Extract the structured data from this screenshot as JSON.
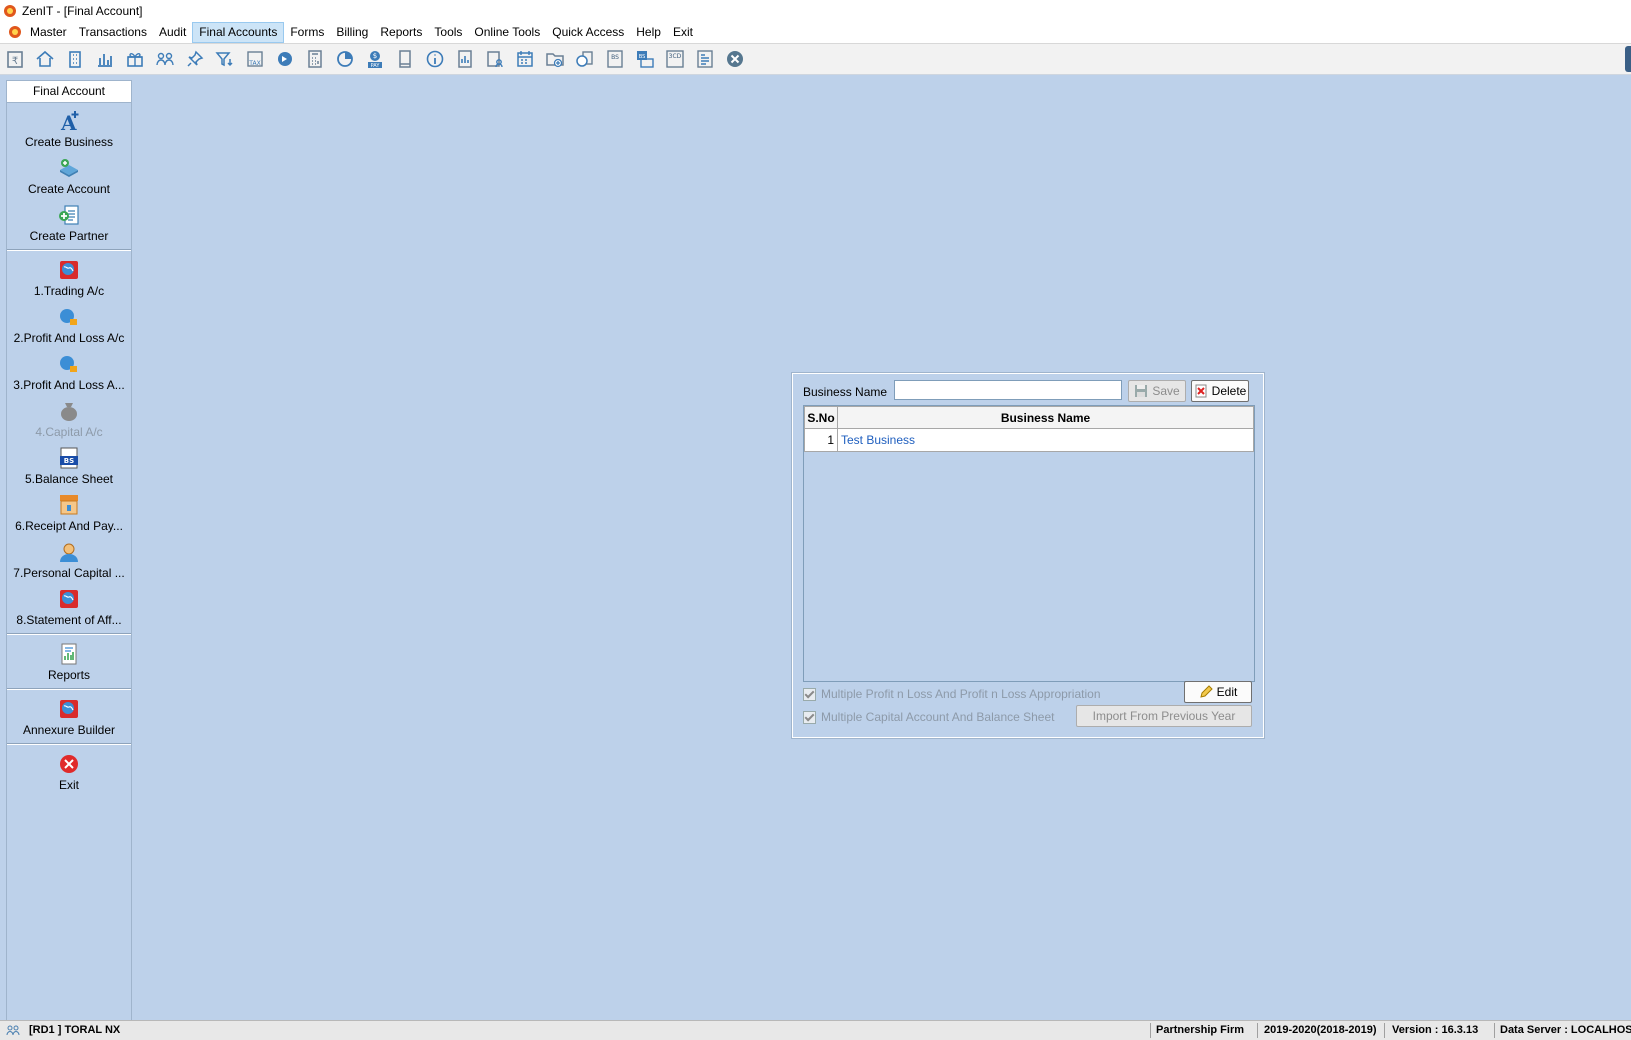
{
  "window": {
    "title": "ZenIT - [Final Account]"
  },
  "menu": {
    "items": [
      "Master",
      "Transactions",
      "Audit",
      "Final Accounts",
      "Forms",
      "Billing",
      "Reports",
      "Tools",
      "Online Tools",
      "Quick Access",
      "Help",
      "Exit"
    ],
    "active": "Final Accounts"
  },
  "toolbar": {
    "icons": [
      "rupee-ledger-icon",
      "home-icon",
      "building-icon",
      "bar-chart-icon",
      "gift-icon",
      "users-icon",
      "pin-icon",
      "filter-icon",
      "tax-icon",
      "refresh-icon",
      "calculator-icon",
      "pie-icon",
      "pay-icon",
      "book-icon",
      "info-icon",
      "report-icon",
      "user-card-icon",
      "calendar-icon",
      "folder-add-icon",
      "chart-circle-icon",
      "bs-icon",
      "bs-group-icon",
      "3cd-icon",
      "document-list-icon",
      "close-circle-icon"
    ]
  },
  "sidebar": {
    "header": "Final Account",
    "items": [
      {
        "label": "Create Business",
        "icon": "create-business-icon"
      },
      {
        "label": "Create Account",
        "icon": "create-account-icon"
      },
      {
        "label": "Create Partner",
        "icon": "create-partner-icon"
      },
      {
        "label": "1.Trading A/c",
        "icon": "trading-icon"
      },
      {
        "label": "2.Profit And Loss A/c",
        "icon": "profit-loss-icon"
      },
      {
        "label": "3.Profit And Loss A...",
        "icon": "profit-loss-appropriation-icon"
      },
      {
        "label": "4.Capital A/c",
        "icon": "capital-bag-icon"
      },
      {
        "label": "5.Balance Sheet",
        "icon": "balance-sheet-icon"
      },
      {
        "label": "6.Receipt And Pay...",
        "icon": "receipt-payment-icon"
      },
      {
        "label": "7.Personal Capital ...",
        "icon": "personal-capital-icon"
      },
      {
        "label": "8.Statement of Aff...",
        "icon": "statement-affairs-icon"
      },
      {
        "label": "Reports",
        "icon": "reports-icon"
      },
      {
        "label": "Annexure Builder",
        "icon": "annexure-builder-icon"
      },
      {
        "label": "Exit",
        "icon": "exit-icon"
      }
    ]
  },
  "dialog": {
    "business_name_label": "Business Name",
    "business_name_value": "",
    "save_label": "Save",
    "delete_label": "Delete",
    "columns": [
      "S.No",
      "Business Name"
    ],
    "rows": [
      {
        "sno": "1",
        "name": "Test Business"
      }
    ],
    "checkbox_multiple_pl": "Multiple Profit n Loss And Profit n Loss Appropriation",
    "checkbox_multiple_capital": "Multiple Capital Account And Balance Sheet",
    "edit_label": "Edit",
    "import_label": "Import From Previous Year"
  },
  "status": {
    "user": "[RD1 ] TORAL NX",
    "firm_type": "Partnership Firm",
    "year": "2019-2020(2018-2019)",
    "version": "Version : 16.3.13",
    "server": "Data Server : LOCALHOST"
  }
}
